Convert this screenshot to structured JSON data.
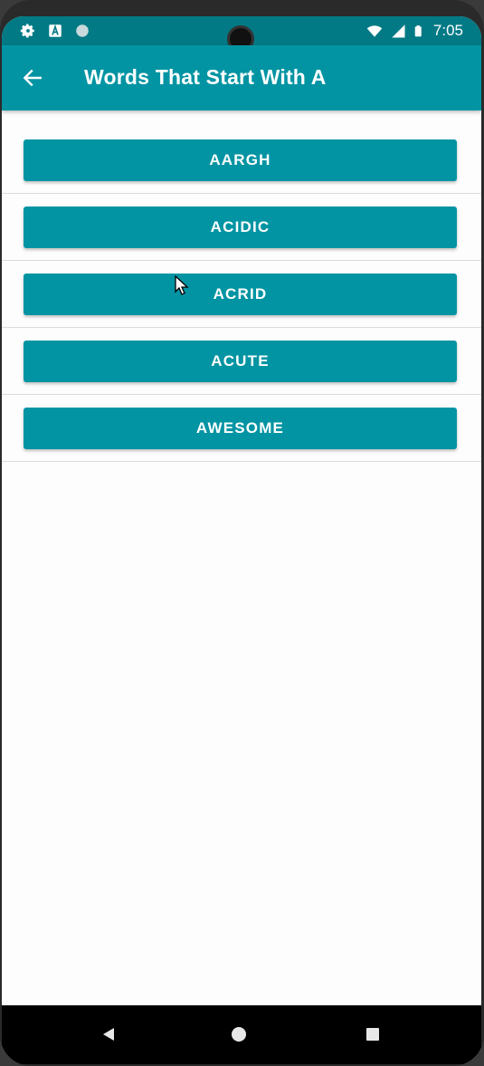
{
  "status_bar": {
    "time": "7:05",
    "icons_left": [
      "gear-icon",
      "a-notification-icon",
      "circle-notification-icon"
    ],
    "icons_right": [
      "wifi-icon",
      "signal-icon",
      "battery-icon"
    ]
  },
  "app_bar": {
    "title": "Words That Start With A",
    "back_icon": "arrow-left-icon",
    "color": "#0294a3"
  },
  "words": [
    {
      "label": "AARGH"
    },
    {
      "label": "ACIDIC"
    },
    {
      "label": "ACRID"
    },
    {
      "label": "ACUTE"
    },
    {
      "label": "AWESOME"
    }
  ],
  "nav_bar": {
    "buttons": [
      "back-triangle-icon",
      "home-circle-icon",
      "recents-square-icon"
    ]
  }
}
